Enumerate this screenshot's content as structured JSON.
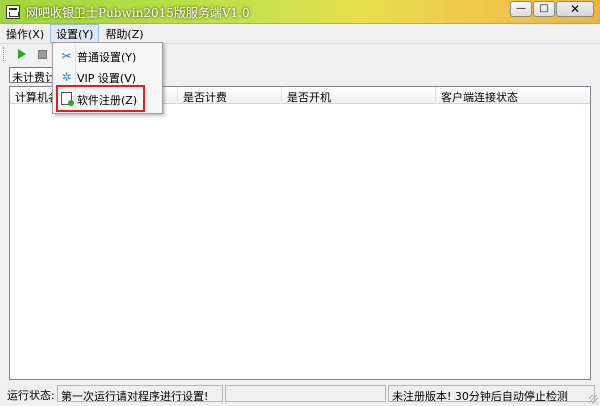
{
  "window": {
    "title": "网吧收银卫士Pubwin2015版服务端V1.0",
    "minimize_glyph": "—",
    "maximize_glyph": "□",
    "close_glyph": "✕"
  },
  "menubar": {
    "items": [
      {
        "label": "操作(X)"
      },
      {
        "label": "设置(Y)"
      },
      {
        "label": "帮助(Z)"
      }
    ]
  },
  "toolbar": {
    "play_icon": "play-icon",
    "stop_icon": "stop-icon"
  },
  "settings_menu": {
    "items": [
      {
        "label": "普通设置(Y)",
        "icon": "wrench-icon"
      },
      {
        "label": "VIP   设置(V)",
        "icon": "gear-icon"
      },
      {
        "label": "软件注册(Z)",
        "icon": "register-icon"
      }
    ],
    "highlighted_index": 2,
    "highlight_color": "#e02020"
  },
  "filter": {
    "selected": "未计费计"
  },
  "table": {
    "columns": [
      "计算机名",
      "是否计费",
      "是否开机",
      "客户端连接状态"
    ],
    "rows": []
  },
  "statusbar": {
    "label": "运行状态:",
    "message": "第一次运行请对程序进行设置!",
    "middle": "",
    "registration": "未注册版本! 30分钟后自动停止检测"
  }
}
